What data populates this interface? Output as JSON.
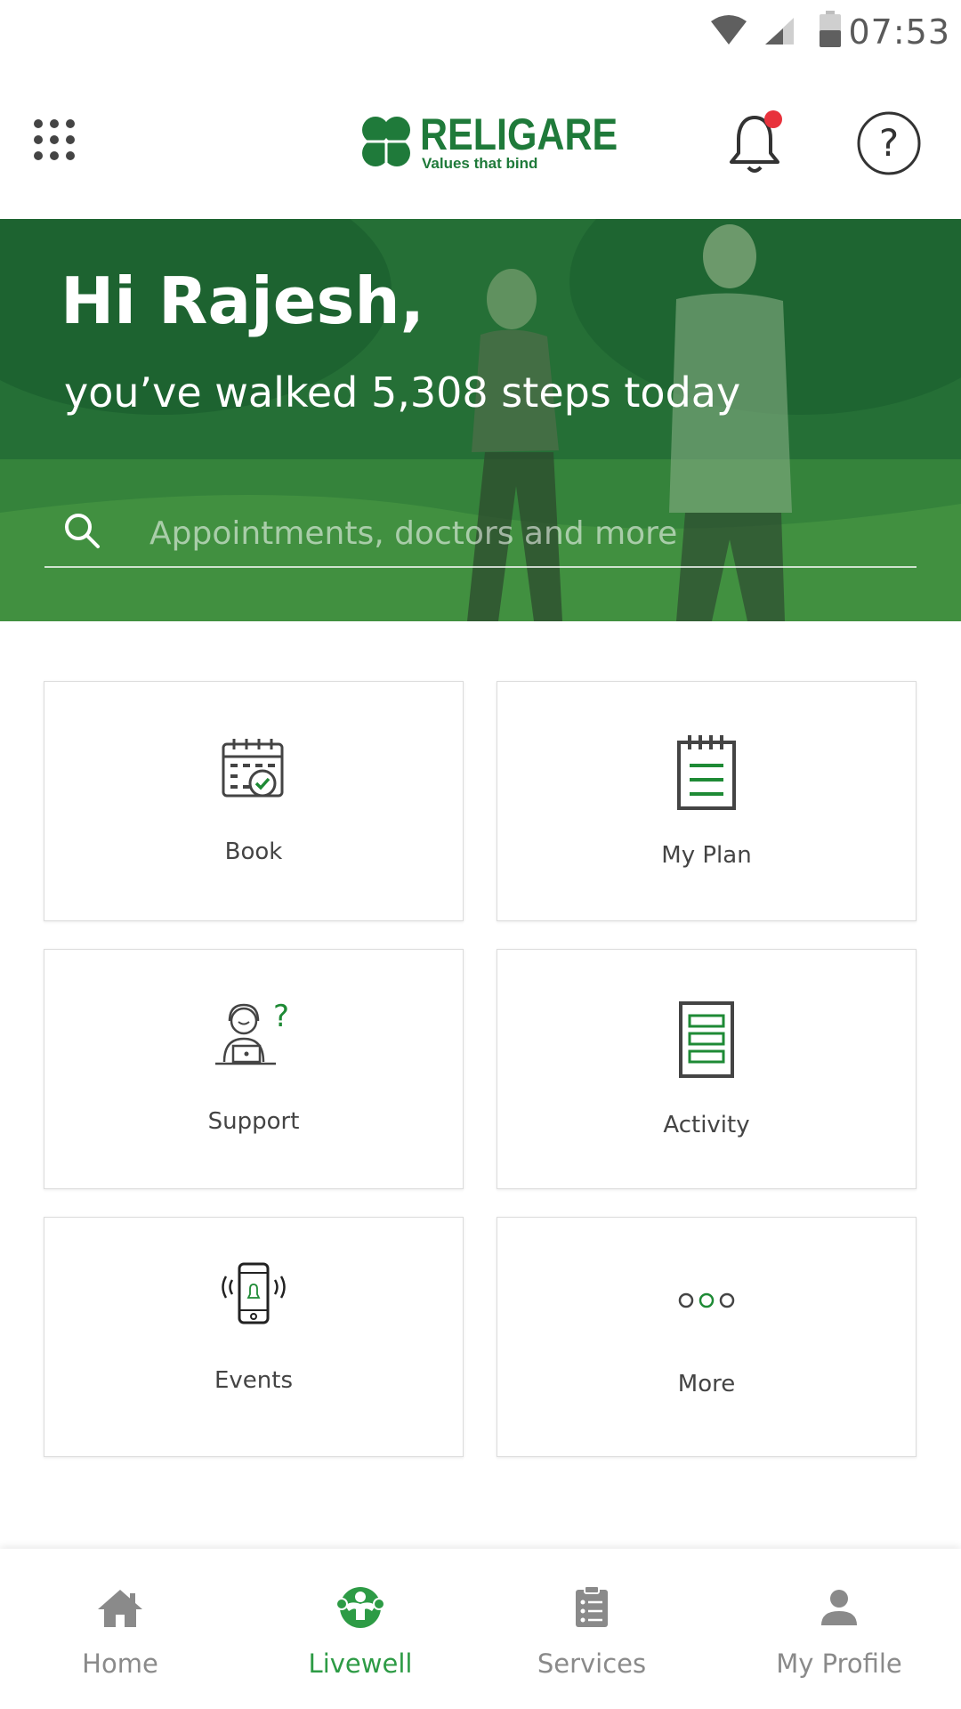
{
  "status_bar": {
    "time": "07:53",
    "icons": [
      "wifi-icon",
      "cell-signal-icon",
      "battery-icon"
    ]
  },
  "header": {
    "menu_icon": "apps-grid-icon",
    "logo": {
      "name": "RELIGARE",
      "tagline": "Values that bind"
    },
    "notification_icon": "bell-icon",
    "notification_badge_color": "#e8323c",
    "help_icon": "help-circle-icon"
  },
  "hero": {
    "greeting": "Hi Rajesh,",
    "steps_text": "you’ve walked 5,308 steps today",
    "search_placeholder": "Appointments, doctors and more"
  },
  "tiles": [
    {
      "label": "Book",
      "icon": "calendar-check-icon"
    },
    {
      "label": "My Plan",
      "icon": "notepad-icon"
    },
    {
      "label": "Support",
      "icon": "support-agent-icon"
    },
    {
      "label": "Activity",
      "icon": "activity-list-icon"
    },
    {
      "label": "Events",
      "icon": "phone-notification-icon"
    },
    {
      "label": "More",
      "icon": "more-dots-icon"
    }
  ],
  "bottom_nav": {
    "active": "Livewell",
    "items": [
      {
        "label": "Home",
        "icon": "home-icon"
      },
      {
        "label": "Livewell",
        "icon": "livewell-icon"
      },
      {
        "label": "Services",
        "icon": "services-icon"
      },
      {
        "label": "My Profile",
        "icon": "profile-icon"
      }
    ]
  },
  "colors": {
    "brand_green": "#1f7a3a",
    "active_nav": "#2d9b45",
    "hero_green": "#2e7d3c"
  }
}
